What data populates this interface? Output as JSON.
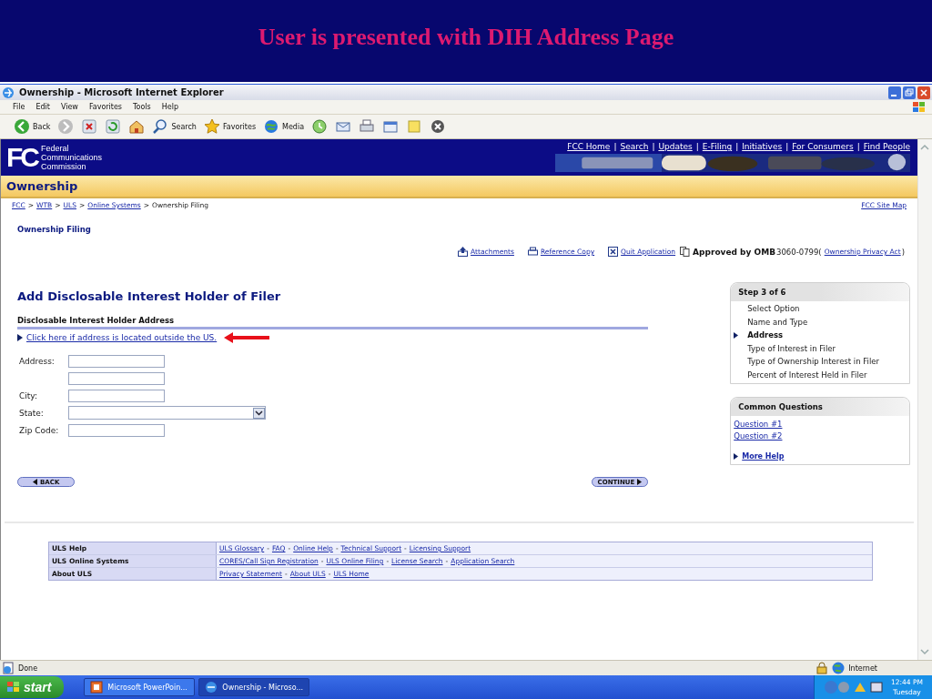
{
  "slide_title": "User is presented with DIH Address Page",
  "browser": {
    "title": "Ownership - Microsoft Internet Explorer",
    "menu": [
      "File",
      "Edit",
      "View",
      "Favorites",
      "Tools",
      "Help"
    ],
    "toolbar": [
      {
        "kind": "back",
        "label": "Back"
      },
      {
        "kind": "forward"
      },
      {
        "kind": "stop"
      },
      {
        "kind": "refresh"
      },
      {
        "kind": "home"
      },
      {
        "kind": "search",
        "label": "Search"
      },
      {
        "kind": "favorites",
        "label": "Favorites"
      },
      {
        "kind": "media",
        "label": "Media"
      },
      {
        "kind": "history"
      },
      {
        "kind": "mail"
      },
      {
        "kind": "print"
      },
      {
        "kind": "edit"
      },
      {
        "kind": "notes"
      },
      {
        "kind": "messenger"
      }
    ]
  },
  "page": {
    "logo_mark": "FC",
    "logo_lines": [
      "Federal",
      "Communications",
      "Commission"
    ],
    "header_links": [
      "FCC Home",
      "Search",
      "Updates",
      "E-Filing",
      "Initiatives",
      "For Consumers",
      "Find People"
    ],
    "header_separator": "|",
    "section_title": "Ownership",
    "breadcrumb": [
      {
        "label": "FCC",
        "link": true
      },
      {
        "label": "WTB",
        "link": true
      },
      {
        "label": "ULS",
        "link": true
      },
      {
        "label": "Online Systems",
        "link": true
      },
      {
        "label": "Ownership Filing",
        "link": false
      }
    ],
    "breadcrumb_separator": ">",
    "site_map": "FCC Site Map",
    "filing_title": "Ownership Filing",
    "actions": [
      {
        "kind": "upload",
        "label": "Attachments"
      },
      {
        "kind": "copy",
        "label": "Reference Copy"
      },
      {
        "kind": "quit",
        "label": "Quit Application"
      }
    ],
    "approval": {
      "label": "Approved by OMB",
      "number": "3060-0799(",
      "link": "Ownership Privacy Act",
      "close": ")"
    },
    "heading": "Add Disclosable Interest Holder of Filer",
    "subheading": "Disclosable Interest Holder Address",
    "outside_link": "Click here if address is located outside the US.",
    "fields": [
      {
        "label": "Address:",
        "kind": "text"
      },
      {
        "kind": "text"
      },
      {
        "label": "City:",
        "kind": "text"
      },
      {
        "label": "State:",
        "kind": "select"
      },
      {
        "label": "Zip Code:",
        "kind": "text"
      }
    ],
    "back_button": "BACK",
    "continue_button": "CONTINUE",
    "steps": {
      "title": "Step 3 of 6",
      "items": [
        {
          "label": "Select Option",
          "selected": false
        },
        {
          "label": "Name and Type",
          "selected": false
        },
        {
          "label": "Address",
          "selected": true
        },
        {
          "label": "Type of Interest in Filer",
          "selected": false
        },
        {
          "label": "Type of Ownership Interest in Filer",
          "selected": false
        },
        {
          "label": "Percent of Interest Held in Filer",
          "selected": false
        }
      ]
    },
    "questions": {
      "title": "Common Questions",
      "links": [
        "Question #1",
        "Question #2"
      ],
      "more": "More Help"
    },
    "footer": {
      "separator": "-",
      "rows": [
        {
          "heading": "ULS Help",
          "links": [
            "ULS Glossary",
            "FAQ",
            "Online Help",
            "Technical Support",
            "Licensing Support"
          ]
        },
        {
          "heading": "ULS Online Systems",
          "links": [
            "CORES/Call Sign Registration",
            "ULS Online Filing",
            "License Search",
            "Application Search"
          ]
        },
        {
          "heading": "About ULS",
          "links": [
            "Privacy Statement",
            "About ULS",
            "ULS Home"
          ]
        }
      ]
    }
  },
  "status_bar": {
    "text": "Done",
    "zone": "Internet"
  },
  "taskbar": {
    "start": "start",
    "tasks": [
      {
        "label": "Microsoft PowerPoin...",
        "kind": "powerpoint",
        "selected": false
      },
      {
        "label": "Ownership - Microso...",
        "kind": "ie",
        "selected": true
      }
    ],
    "time": "12:44 PM",
    "day": "Tuesday"
  }
}
